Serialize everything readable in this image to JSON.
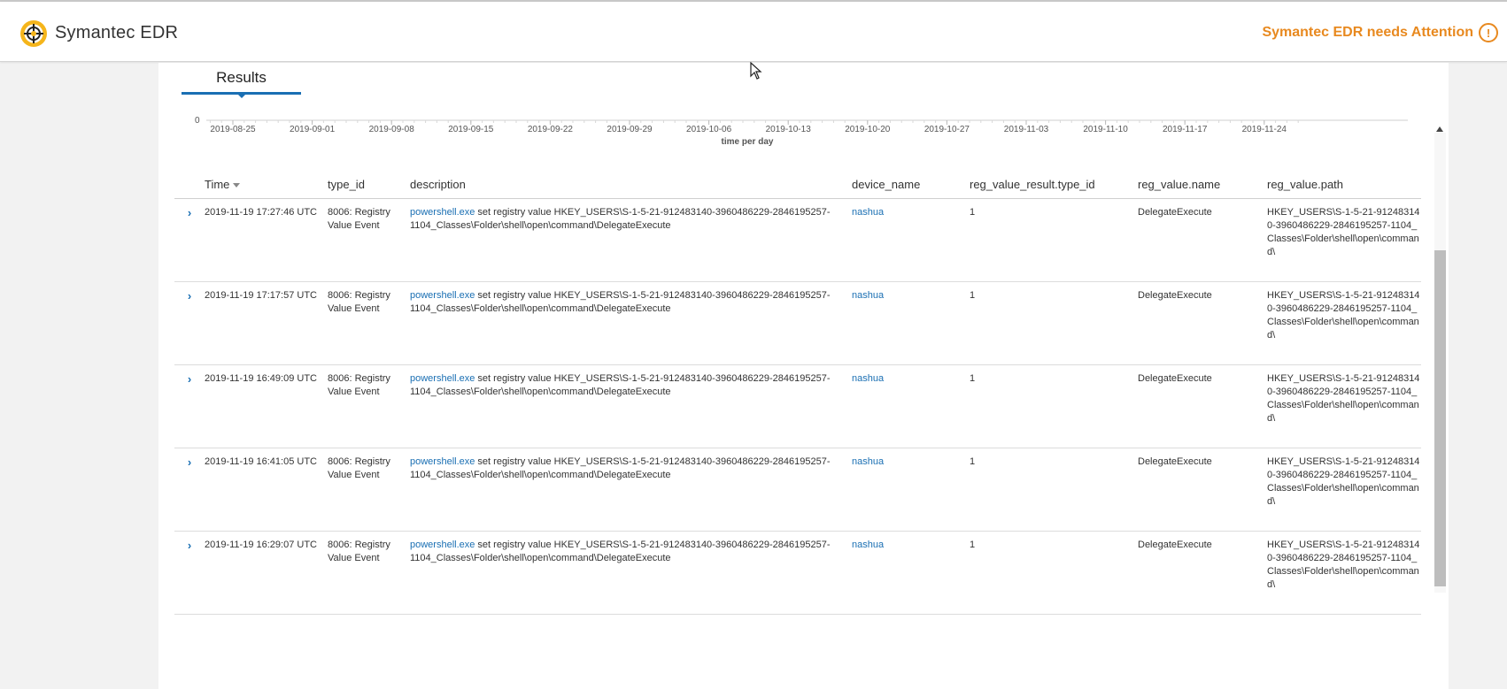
{
  "app": {
    "brand": "Symantec EDR",
    "attention_text": "Symantec EDR needs Attention",
    "attention_icon": "!",
    "accent_color": "#e8891f",
    "link_color": "#1a6fb3"
  },
  "tabs": {
    "results_label": "Results"
  },
  "chart_data": {
    "type": "bar",
    "xlabel": "time per day",
    "y_tick": "0",
    "x_ticks": [
      "2019-08-25",
      "2019-09-01",
      "2019-09-08",
      "2019-09-15",
      "2019-09-22",
      "2019-09-29",
      "2019-10-06",
      "2019-10-13",
      "2019-10-20",
      "2019-10-27",
      "2019-11-03",
      "2019-11-10",
      "2019-11-17",
      "2019-11-24"
    ]
  },
  "table": {
    "headers": {
      "time": "Time",
      "type_id": "type_id",
      "description": "description",
      "device_name": "device_name",
      "reg_value_result_type_id": "reg_value_result.type_id",
      "reg_value_name": "reg_value.name",
      "reg_value_path": "reg_value.path"
    },
    "rows": [
      {
        "time": "2019-11-19 17:27:46 UTC",
        "type_id": "8006: Registry Value Event",
        "desc_link": "powershell.exe",
        "desc_rest": " set registry value HKEY_USERS\\S-1-5-21-912483140-3960486229-2846195257-1104_Classes\\Folder\\shell\\open\\command\\DelegateExecute",
        "device": "nashua",
        "result_type": "1",
        "name": "DelegateExecute",
        "path": "HKEY_USERS\\S-1-5-21-912483140-3960486229-2846195257-1104_Classes\\Folder\\shell\\open\\command\\"
      },
      {
        "time": "2019-11-19 17:17:57 UTC",
        "type_id": "8006: Registry Value Event",
        "desc_link": "powershell.exe",
        "desc_rest": " set registry value HKEY_USERS\\S-1-5-21-912483140-3960486229-2846195257-1104_Classes\\Folder\\shell\\open\\command\\DelegateExecute",
        "device": "nashua",
        "result_type": "1",
        "name": "DelegateExecute",
        "path": "HKEY_USERS\\S-1-5-21-912483140-3960486229-2846195257-1104_Classes\\Folder\\shell\\open\\command\\"
      },
      {
        "time": "2019-11-19 16:49:09 UTC",
        "type_id": "8006: Registry Value Event",
        "desc_link": "powershell.exe",
        "desc_rest": " set registry value HKEY_USERS\\S-1-5-21-912483140-3960486229-2846195257-1104_Classes\\Folder\\shell\\open\\command\\DelegateExecute",
        "device": "nashua",
        "result_type": "1",
        "name": "DelegateExecute",
        "path": "HKEY_USERS\\S-1-5-21-912483140-3960486229-2846195257-1104_Classes\\Folder\\shell\\open\\command\\"
      },
      {
        "time": "2019-11-19 16:41:05 UTC",
        "type_id": "8006: Registry Value Event",
        "desc_link": "powershell.exe",
        "desc_rest": " set registry value HKEY_USERS\\S-1-5-21-912483140-3960486229-2846195257-1104_Classes\\Folder\\shell\\open\\command\\DelegateExecute",
        "device": "nashua",
        "result_type": "1",
        "name": "DelegateExecute",
        "path": "HKEY_USERS\\S-1-5-21-912483140-3960486229-2846195257-1104_Classes\\Folder\\shell\\open\\command\\"
      },
      {
        "time": "2019-11-19 16:29:07 UTC",
        "type_id": "8006: Registry Value Event",
        "desc_link": "powershell.exe",
        "desc_rest": " set registry value HKEY_USERS\\S-1-5-21-912483140-3960486229-2846195257-1104_Classes\\Folder\\shell\\open\\command\\DelegateExecute",
        "device": "nashua",
        "result_type": "1",
        "name": "DelegateExecute",
        "path": "HKEY_USERS\\S-1-5-21-912483140-3960486229-2846195257-1104_Classes\\Folder\\shell\\open\\command\\"
      }
    ]
  }
}
